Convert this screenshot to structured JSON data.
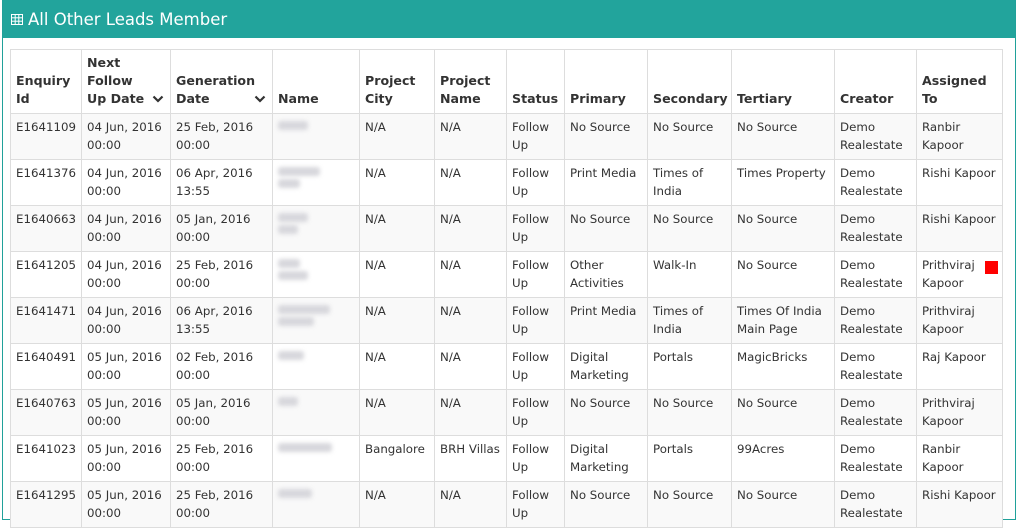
{
  "panel": {
    "title": "All Other Leads Member",
    "header_color": "#22a49c",
    "title_icon": "table-icon"
  },
  "table": {
    "headers": {
      "enquiry_id": "Enquiry Id",
      "next_follow_up": "Next Follow Up Date",
      "generation_date": "Generation Date",
      "name": "Name",
      "project_city": "Project City",
      "project_name": "Project Name",
      "status": "Status",
      "primary": "Primary",
      "secondary": "Secondary",
      "tertiary": "Tertiary",
      "creator": "Creator",
      "assigned_to": "Assigned To"
    },
    "rows": [
      {
        "id": "E1641109",
        "next": "04 Jun, 2016 00:00",
        "gen": "25 Feb, 2016 00:00",
        "city": "N/A",
        "project": "N/A",
        "status": "Follow Up",
        "primary": "No Source",
        "secondary": "No Source",
        "tertiary": "No Source",
        "creator": "Demo Realestate",
        "assigned": "Ranbir Kapoor"
      },
      {
        "id": "E1641376",
        "next": "04 Jun, 2016 00:00",
        "gen": "06 Apr, 2016 13:55",
        "city": "N/A",
        "project": "N/A",
        "status": "Follow Up",
        "primary": "Print Media",
        "secondary": "Times of India",
        "tertiary": "Times Property",
        "creator": "Demo Realestate",
        "assigned": "Rishi Kapoor"
      },
      {
        "id": "E1640663",
        "next": "04 Jun, 2016 00:00",
        "gen": "05 Jan, 2016 00:00",
        "city": "N/A",
        "project": "N/A",
        "status": "Follow Up",
        "primary": "No Source",
        "secondary": "No Source",
        "tertiary": "No Source",
        "creator": "Demo Realestate",
        "assigned": "Rishi Kapoor"
      },
      {
        "id": "E1641205",
        "next": "04 Jun, 2016 00:00",
        "gen": "25 Feb, 2016 00:00",
        "city": "N/A",
        "project": "N/A",
        "status": "Follow Up",
        "primary": "Other Activities",
        "secondary": "Walk-In",
        "tertiary": "No Source",
        "creator": "Demo Realestate",
        "assigned": "Prithviraj Kapoor"
      },
      {
        "id": "E1641471",
        "next": "04 Jun, 2016 00:00",
        "gen": "06 Apr, 2016 13:55",
        "city": "N/A",
        "project": "N/A",
        "status": "Follow Up",
        "primary": "Print Media",
        "secondary": "Times of India",
        "tertiary": "Times Of India Main Page",
        "creator": "Demo Realestate",
        "assigned": "Prithviraj Kapoor"
      },
      {
        "id": "E1640491",
        "next": "05 Jun, 2016 00:00",
        "gen": "02 Feb, 2016 00:00",
        "city": "N/A",
        "project": "N/A",
        "status": "Follow Up",
        "primary": "Digital Marketing",
        "secondary": "Portals",
        "tertiary": "MagicBricks",
        "creator": "Demo Realestate",
        "assigned": "Raj Kapoor"
      },
      {
        "id": "E1640763",
        "next": "05 Jun, 2016 00:00",
        "gen": "05 Jan, 2016 00:00",
        "city": "N/A",
        "project": "N/A",
        "status": "Follow Up",
        "primary": "No Source",
        "secondary": "No Source",
        "tertiary": "No Source",
        "creator": "Demo Realestate",
        "assigned": "Prithviraj Kapoor"
      },
      {
        "id": "E1641023",
        "next": "05 Jun, 2016 00:00",
        "gen": "25 Feb, 2016 00:00",
        "city": "Bangalore",
        "project": "BRH Villas",
        "status": "Follow Up",
        "primary": "Digital Marketing",
        "secondary": "Portals",
        "tertiary": "99Acres",
        "creator": "Demo Realestate",
        "assigned": "Ranbir Kapoor"
      },
      {
        "id": "E1641295",
        "next": "05 Jun, 2016 00:00",
        "gen": "25 Feb, 2016 00:00",
        "city": "N/A",
        "project": "N/A",
        "status": "Follow Up",
        "primary": "No Source",
        "secondary": "No Source",
        "tertiary": "No Source",
        "creator": "Demo Realestate",
        "assigned": "Rishi Kapoor"
      }
    ]
  },
  "marker_color": "#ff0000"
}
